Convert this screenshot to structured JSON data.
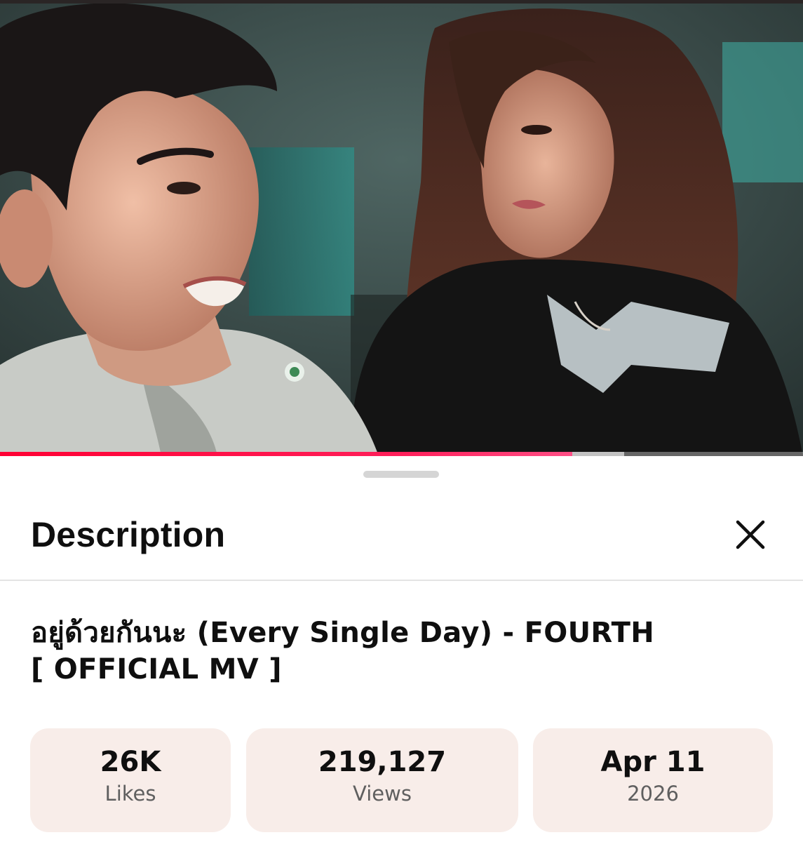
{
  "player": {
    "progress_fraction": 0.713,
    "buffered_fraction": 0.777,
    "colors": {
      "progress": "#ff0033",
      "buffer": "#d2d2d2"
    }
  },
  "sheet": {
    "title": "Description",
    "close_icon": "close-icon",
    "video_title_line1": "อยู่ด้วยกันนะ (Every Single Day) - FOURTH",
    "video_title_line2": "[ OFFICIAL MV ]"
  },
  "stats": [
    {
      "value": "26K",
      "label": "Likes"
    },
    {
      "value": "219,127",
      "label": "Views"
    },
    {
      "value": "Apr 11",
      "label": "2026"
    }
  ],
  "colors": {
    "stat_card_bg": "#f8ede9",
    "text_primary": "#0f0f0f",
    "text_secondary": "#5f5f5f"
  }
}
